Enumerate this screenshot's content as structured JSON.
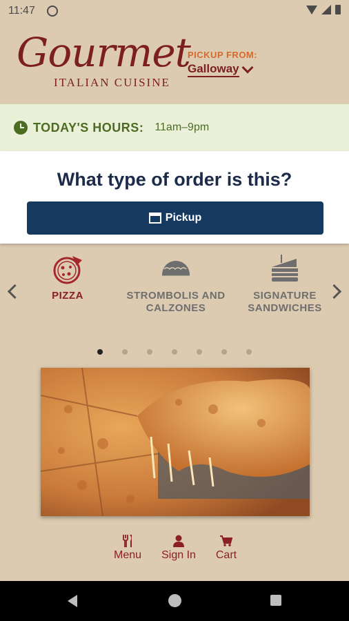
{
  "status_bar": {
    "time": "11:47"
  },
  "brand": {
    "script": "Gourmet",
    "sub": "ITALIAN CUISINE"
  },
  "pickup": {
    "label": "PICKUP FROM:",
    "location": "Galloway"
  },
  "hours": {
    "label": "TODAY'S HOURS:",
    "value": "11am–9pm"
  },
  "order": {
    "question": "What type of order is this?",
    "button": "Pickup"
  },
  "categories": [
    {
      "line1": "PIZZA",
      "line2": ""
    },
    {
      "line1": "STROMBOLIS AND",
      "line2": "CALZONES"
    },
    {
      "line1": "SIGNATURE",
      "line2": "SANDWICHES"
    }
  ],
  "carousel": {
    "total": 7,
    "active": 1
  },
  "nav": {
    "menu": "Menu",
    "signin": "Sign In",
    "cart": "Cart"
  },
  "colors": {
    "background": "#dccbb1",
    "brand": "#7c1e22",
    "button": "#163a5f",
    "hours_bg": "#eaf1d8",
    "accent_orange": "#d46a2e"
  }
}
